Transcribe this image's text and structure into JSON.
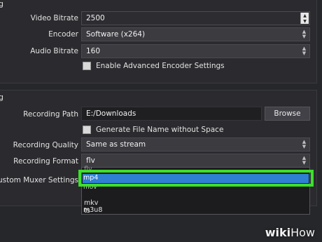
{
  "streaming": {
    "section_title": "g",
    "video_bitrate_label": "Video Bitrate",
    "video_bitrate_value": "2500",
    "encoder_label": "Encoder",
    "encoder_value": "Software (x264)",
    "audio_bitrate_label": "Audio Bitrate",
    "audio_bitrate_value": "160",
    "advanced_encoder_label": "Enable Advanced Encoder Settings"
  },
  "recording": {
    "section_title": "g",
    "path_label": "Recording Path",
    "path_value": "E:/Downloads",
    "browse_label": "Browse",
    "no_space_label": "Generate File Name without Space",
    "quality_label": "Recording Quality",
    "quality_value": "Same as stream",
    "format_label": "Recording Format",
    "format_value": "flv",
    "muxer_label": "Custom Muxer Settings",
    "format_options": [
      "flv",
      "mp4",
      "mov",
      "mkv",
      "ts",
      "m3u8"
    ],
    "selected_option": "mp4"
  },
  "watermark": {
    "wiki": "wiki",
    "how": "How"
  },
  "colors": {
    "highlight": "#2f7fd2",
    "annotation_box": "#3ce02b"
  }
}
